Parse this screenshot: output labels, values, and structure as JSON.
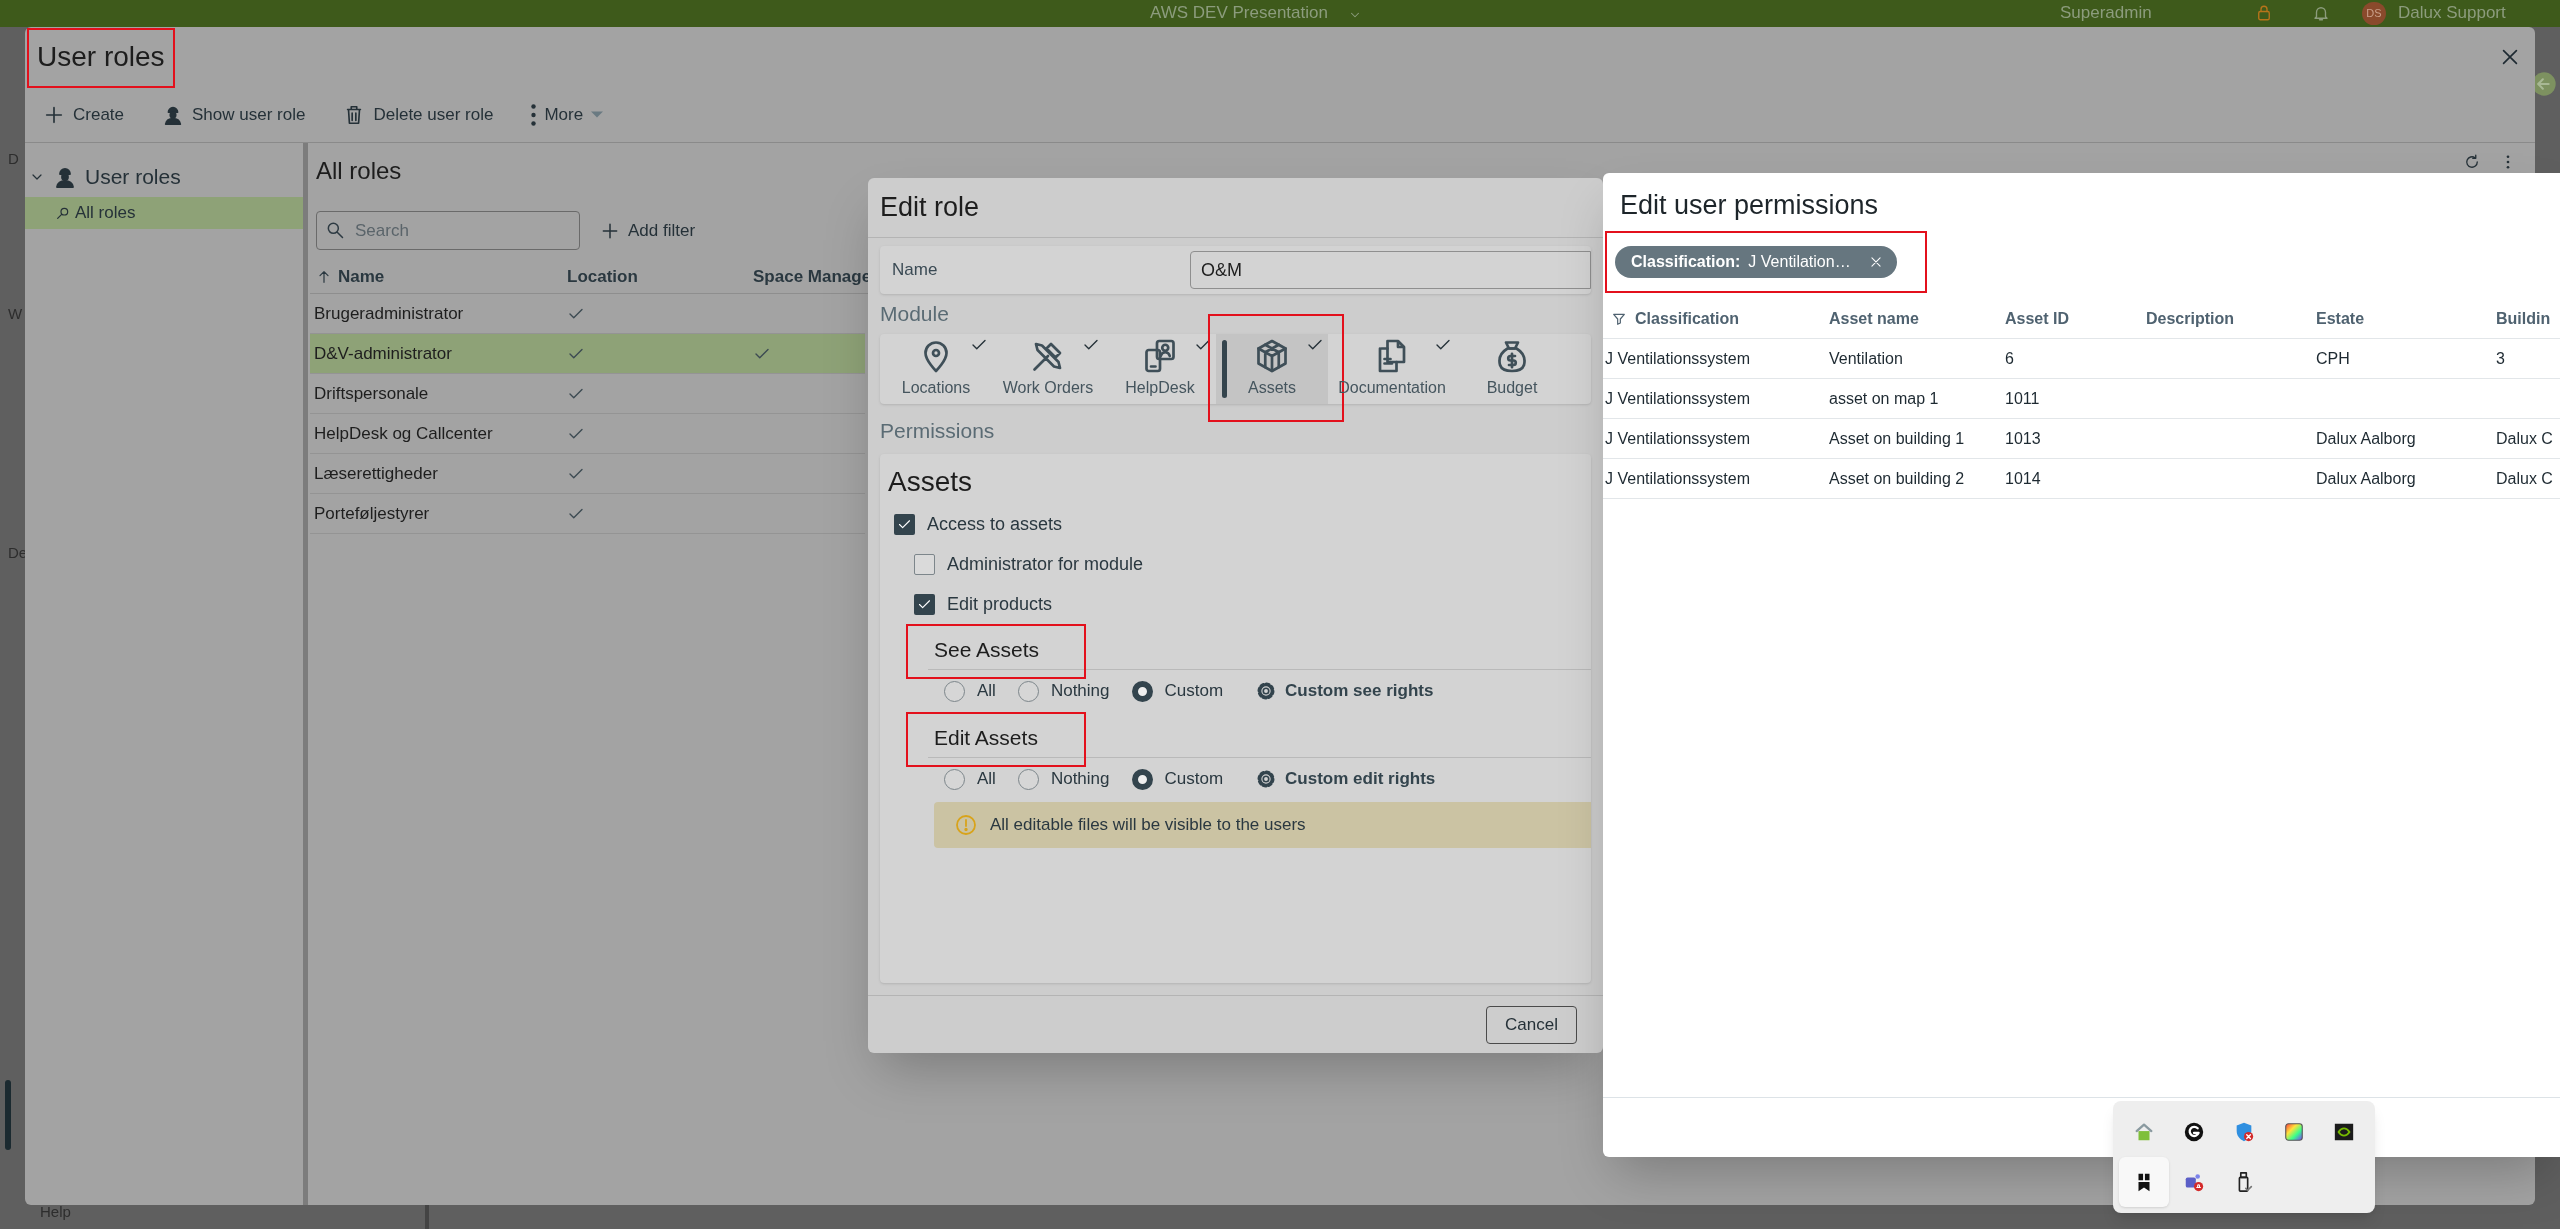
{
  "top_bar": {
    "project": "AWS DEV Presentation",
    "role": "Superadmin",
    "avatar": "DS",
    "user": "Dalux Support"
  },
  "side_nav": {
    "fragments": [
      "D",
      "W",
      "De"
    ],
    "help": "Help"
  },
  "user_roles_window": {
    "title": {
      "text": "User roles",
      "annotated": true
    },
    "toolbar": [
      {
        "kind": "create",
        "label": "Create"
      },
      {
        "kind": "show",
        "label": "Show user role"
      },
      {
        "kind": "delete",
        "label": "Delete user role"
      },
      {
        "kind": "more",
        "label": "More"
      }
    ],
    "tree": [
      {
        "label": "User roles",
        "expanded": true,
        "children": [
          {
            "label": "All roles",
            "selected": true
          }
        ]
      }
    ],
    "list_title": "All roles",
    "search": {
      "placeholder": "Search"
    },
    "add_filter": "Add filter",
    "columns": [
      {
        "label": "Name",
        "sorted": true
      },
      {
        "label": "Location",
        "sorted": false
      },
      {
        "label": "Space Manage",
        "sorted": false
      }
    ],
    "rows": [
      {
        "name": "Brugeradministrator",
        "location": true,
        "space_manage": false,
        "selected": false
      },
      {
        "name": "D&V-administrator",
        "location": true,
        "space_manage": true,
        "selected": true
      },
      {
        "name": "Driftspersonale",
        "location": true,
        "space_manage": false,
        "selected": false
      },
      {
        "name": "HelpDesk og Callcenter",
        "location": true,
        "space_manage": false,
        "selected": false
      },
      {
        "name": "Læserettigheder",
        "location": true,
        "space_manage": false,
        "selected": false
      },
      {
        "name": "Porteføljestyrer",
        "location": true,
        "space_manage": false,
        "selected": false
      }
    ]
  },
  "edit_role": {
    "title": "Edit role",
    "name_label": "Name",
    "name_value": "O&M",
    "module_label": "Module",
    "modules": [
      {
        "kind": "pin",
        "label": "Locations",
        "enabled": true,
        "selected": false,
        "annotated": false
      },
      {
        "kind": "tools",
        "label": "Work Orders",
        "enabled": true,
        "selected": false,
        "annotated": false
      },
      {
        "kind": "phone",
        "label": "HelpDesk",
        "enabled": true,
        "selected": false,
        "annotated": false
      },
      {
        "kind": "cube",
        "label": "Assets",
        "enabled": true,
        "selected": true,
        "annotated": true
      },
      {
        "kind": "docs",
        "label": "Documentation",
        "enabled": true,
        "selected": false,
        "annotated": false
      },
      {
        "kind": "bag",
        "label": "Budget",
        "enabled": false,
        "selected": false,
        "annotated": false
      }
    ],
    "permissions_label": "Permissions",
    "section_title": "Assets",
    "options": [
      {
        "label": "Access to assets",
        "checked": true,
        "children": [
          {
            "label": "Administrator for module",
            "checked": false
          },
          {
            "label": "Edit products",
            "checked": true
          }
        ]
      }
    ],
    "rights": [
      {
        "title": "See Assets",
        "annotated": true,
        "choices": [
          {
            "label": "All",
            "selected": false
          },
          {
            "label": "Nothing",
            "selected": false
          },
          {
            "label": "Custom",
            "selected": true
          }
        ],
        "link": "Custom see rights"
      },
      {
        "title": "Edit Assets",
        "annotated": true,
        "choices": [
          {
            "label": "All",
            "selected": false
          },
          {
            "label": "Nothing",
            "selected": false
          },
          {
            "label": "Custom",
            "selected": true
          }
        ],
        "link": "Custom edit rights"
      }
    ],
    "notice": "All editable files will be visible to the users",
    "buttons": [
      "Cancel"
    ]
  },
  "edit_user_permissions": {
    "title": "Edit user permissions",
    "filter_chip": {
      "field": "Classification:",
      "value": "J Ventilation…",
      "annotated": true
    },
    "columns": [
      "Classification",
      "Asset name",
      "Asset ID",
      "Description",
      "Estate",
      "Buildin"
    ],
    "rows": [
      {
        "classification": "J Ventilationssystem",
        "asset_name": "Ventilation",
        "asset_id": "6",
        "estate": "CPH",
        "building": "3"
      },
      {
        "classification": "J Ventilationssystem",
        "asset_name": "asset on map 1",
        "asset_id": "1011"
      },
      {
        "classification": "J Ventilationssystem",
        "asset_name": "Asset on building 1",
        "asset_id": "1013",
        "estate": "Dalux Aalborg",
        "building": "Dalux C"
      },
      {
        "classification": "J Ventilationssystem",
        "asset_name": "Asset on building 2",
        "asset_id": "1014",
        "estate": "Dalux Aalborg",
        "building": "Dalux C"
      }
    ]
  },
  "tray": {
    "icons": [
      {
        "kind": "home",
        "selected": false
      },
      {
        "kind": "g",
        "selected": false
      },
      {
        "kind": "shield",
        "selected": false
      },
      {
        "kind": "palette",
        "selected": false
      },
      {
        "kind": "eye",
        "selected": false
      },
      {
        "kind": "bookmark",
        "selected": true
      },
      {
        "kind": "people",
        "selected": false
      },
      {
        "kind": "usb",
        "selected": false
      }
    ]
  }
}
